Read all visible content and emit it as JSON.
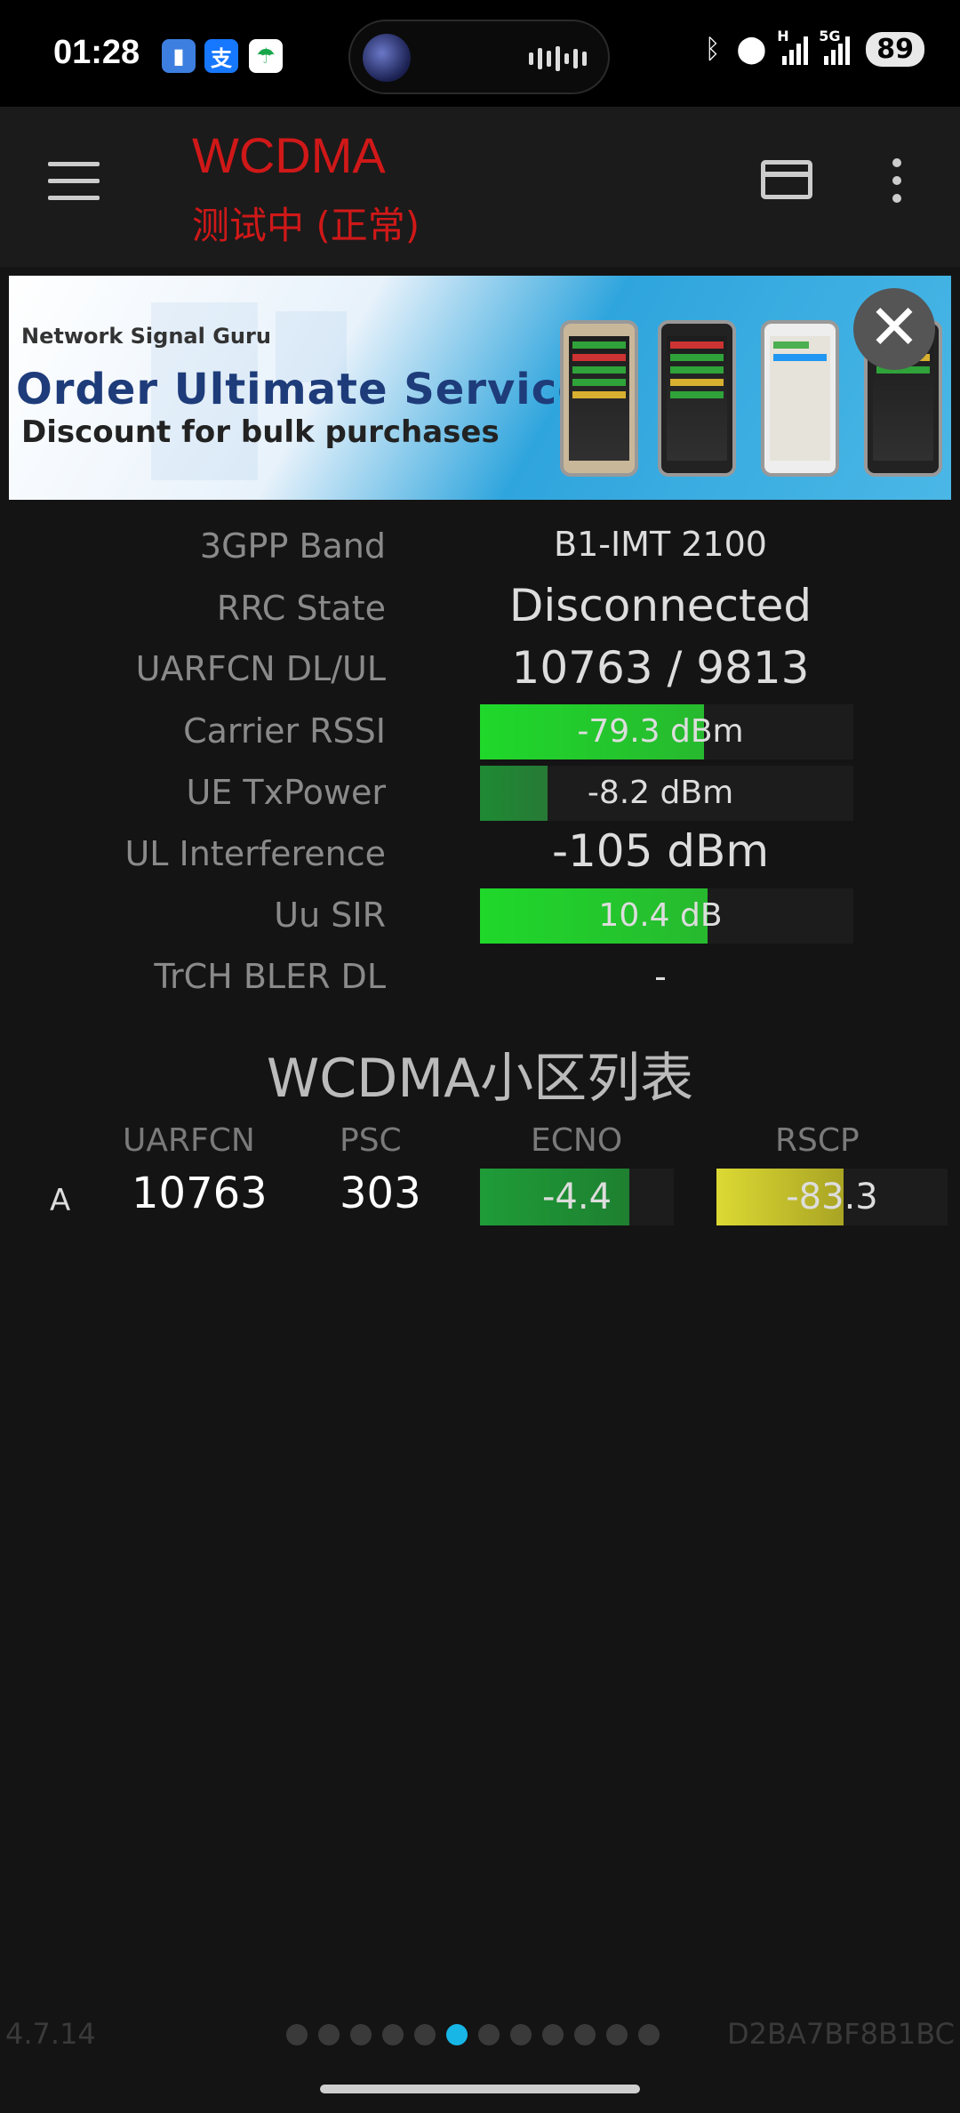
{
  "status_bar": {
    "time": "01:28",
    "battery": "89",
    "icons": [
      "bluetooth-icon",
      "location-icon",
      "signal-h-icon",
      "signal-5g-icon"
    ],
    "network_labels": {
      "h": "H",
      "fiveg": "5G"
    }
  },
  "app_bar": {
    "title": "WCDMA",
    "status": "测试中 (正常)"
  },
  "ad": {
    "brand": "Network Signal Guru",
    "headline": "Order Ultimate Service",
    "subline": "Discount for bulk purchases",
    "close_glyph": "✕"
  },
  "info": {
    "rows": [
      {
        "label": "3GPP Band",
        "value": "B1-IMT 2100"
      },
      {
        "label": "RRC State",
        "value": "Disconnected"
      },
      {
        "label": "UARFCN DL/UL",
        "value": "10763 / 9813"
      },
      {
        "label": "Carrier RSSI",
        "value": "-79.3 dBm",
        "level": 0.6
      },
      {
        "label": "UE TxPower",
        "value": "-8.2 dBm",
        "level": 0.18
      },
      {
        "label": "UL Interference",
        "value": "-105 dBm"
      },
      {
        "label": "Uu SIR",
        "value": "10.4 dB",
        "level": 0.61
      },
      {
        "label": "TrCH BLER DL",
        "value": "-"
      }
    ]
  },
  "cell_list": {
    "title": "WCDMA小区列表",
    "headers": [
      "UARFCN",
      "PSC",
      "ECNO",
      "RSCP"
    ],
    "rows": [
      {
        "type": "A",
        "uarfcn": "10763",
        "psc": "303",
        "ecno": "-4.4",
        "ecno_level": 0.77,
        "rscp": "-83.3",
        "rscp_level": 0.55
      }
    ]
  },
  "footer": {
    "version": "4.7.14",
    "device_id": "D2BA7BF8B1BC",
    "page_count": 12,
    "active_page": 6
  },
  "colors": {
    "title_red": "#d01818",
    "bar_green": "#22d42a",
    "bar_dark_green": "#1e8a34",
    "bar_yellow": "#d8d630",
    "active_dot": "#17b6e6"
  }
}
